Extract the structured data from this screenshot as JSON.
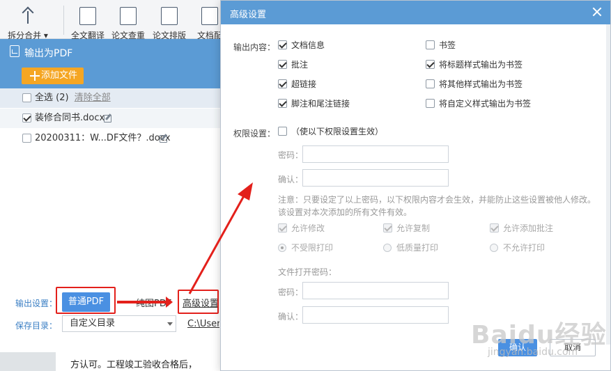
{
  "ribbon": {
    "items": [
      {
        "label": "拆分合并 ▾"
      },
      {
        "label": "全文翻译"
      },
      {
        "label": "论文查重"
      },
      {
        "label": "论文排版"
      },
      {
        "label": "文档配"
      }
    ]
  },
  "document": {
    "line": "方认可。工程竣工验收合格后，"
  },
  "pdf_panel": {
    "title": "输出为PDF",
    "add_file": "添加文件",
    "select_all": "全选 (2)",
    "clear_all": "清除全部",
    "files": [
      {
        "name": "装修合同书.docx",
        "checked": true
      },
      {
        "name": "20200311：W...DF文件？.docx",
        "checked": false
      }
    ],
    "output_label": "输出设置：",
    "normal_pdf": "普通PDF",
    "image_pdf": "纯图PDF",
    "advanced": "高级设置",
    "save_label": "保存目录：",
    "save_dir": "自定义目录",
    "save_path": "C:\\Users"
  },
  "dialog": {
    "title": "高级设置",
    "output_content_label": "输出内容：",
    "content_options": [
      {
        "label": "文档信息",
        "checked": true
      },
      {
        "label": "批注",
        "checked": true
      },
      {
        "label": "超链接",
        "checked": true
      },
      {
        "label": "脚注和尾注链接",
        "checked": true
      }
    ],
    "bookmark_options": [
      {
        "label": "书签",
        "checked": false
      },
      {
        "label": "将标题样式输出为书签",
        "checked": true
      },
      {
        "label": "将其他样式输出为书签",
        "checked": false
      },
      {
        "label": "将自定义样式输出为书签",
        "checked": false
      }
    ],
    "permission_label": "权限设置：",
    "permission_enable": "（使以下权限设置生效）",
    "password_label": "密码：",
    "confirm_label": "确认：",
    "note": "注意：只要设定了以上密码，以下权限内容才会生效，并能防止这些设置被他人修改。该设置对本次添加的所有文件有效。",
    "permissions": [
      {
        "label": "允许修改",
        "checked": true
      },
      {
        "label": "允许复制",
        "checked": true
      },
      {
        "label": "允许添加批注",
        "checked": true
      }
    ],
    "print_options": [
      {
        "label": "不受限打印",
        "selected": true
      },
      {
        "label": "低质量打印",
        "selected": false
      },
      {
        "label": "不允许打印",
        "selected": false
      }
    ],
    "open_password_label": "文件打开密码：",
    "ok": "确认",
    "cancel": "取消"
  },
  "watermark": {
    "text": "Baidu经验",
    "sub": "jingyan.baidu.com"
  },
  "colors": {
    "accent": "#5b9bd5",
    "button": "#4a90e2",
    "orange": "#f5a623",
    "annotation": "#e3201b"
  }
}
